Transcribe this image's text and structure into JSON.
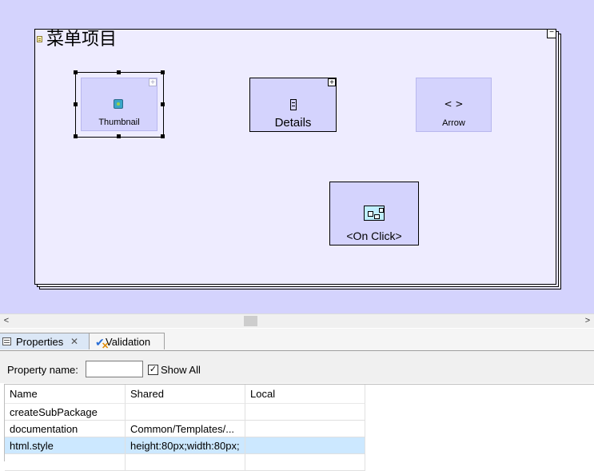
{
  "diagram": {
    "frame": {
      "title": "菜单项目",
      "icon": "package-icon",
      "collapse_glyph": "−"
    },
    "nodes": {
      "thumbnail": {
        "label": "Thumbnail",
        "icon": "image-icon",
        "expand_glyph": "+"
      },
      "details": {
        "label": "Details",
        "icon": "list-icon",
        "expand_glyph": "+"
      },
      "arrow": {
        "label": "Arrow",
        "icon": "code-brackets-icon",
        "glyph": "< >"
      },
      "onclick": {
        "label": "<On Click>",
        "icon": "activity-diagram-icon"
      }
    }
  },
  "scrollbar": {
    "left_arrow": "<",
    "right_arrow": ">"
  },
  "properties": {
    "tabs": [
      {
        "label": "Properties",
        "icon": "properties-icon",
        "close": "✕"
      },
      {
        "label": "Validation",
        "icon": "validation-icon"
      }
    ],
    "filter": {
      "label": "Property name:",
      "value": "",
      "show_all_label": "Show All",
      "show_all_checked": "✓"
    },
    "table": {
      "columns": [
        "Name",
        "Shared",
        "Local"
      ],
      "rows": [
        {
          "name": "createSubPackage",
          "shared": "",
          "local": ""
        },
        {
          "name": "documentation",
          "shared": "Common/Templates/...",
          "local": ""
        },
        {
          "name": "html.style",
          "shared": "height:80px;width:80px;",
          "local": ""
        }
      ],
      "selected_row": "html.style"
    }
  }
}
